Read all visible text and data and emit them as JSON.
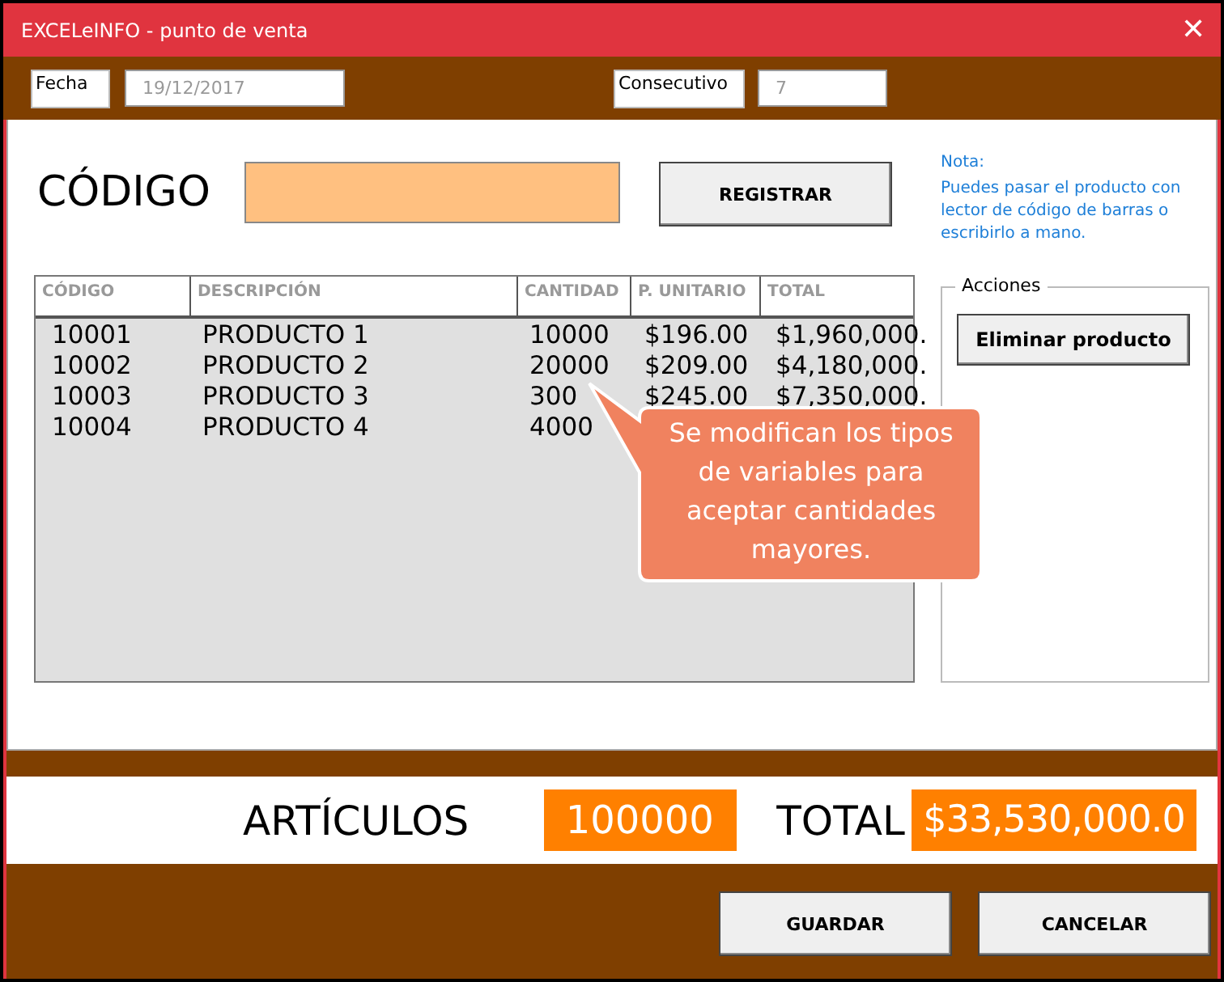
{
  "window": {
    "title": "EXCELeINFO - punto de venta",
    "close_glyph": "✕"
  },
  "header": {
    "date_label": "Fecha",
    "date_value": "19/12/2017",
    "consecutive_label": "Consecutivo",
    "consecutive_value": "7"
  },
  "code": {
    "label": "CÓDIGO",
    "register_button": "REGISTRAR"
  },
  "note": {
    "title": "Nota:",
    "text": "Puedes pasar el producto con lector de código de barras o escribirlo a mano."
  },
  "table": {
    "columns": [
      "CÓDIGO",
      "DESCRIPCIÓN",
      "CANTIDAD",
      "P. UNITARIO",
      "TOTAL"
    ],
    "rows": [
      [
        "10001",
        "PRODUCTO 1",
        "10000",
        "$196.00",
        "$1,960,000."
      ],
      [
        "10002",
        "PRODUCTO 2",
        "20000",
        "$209.00",
        "$4,180,000."
      ],
      [
        "10003",
        "PRODUCTO 3",
        "300",
        "$245.00",
        "$7,350,000."
      ],
      [
        "10004",
        "PRODUCTO 4",
        "4000"
      ]
    ]
  },
  "callout": {
    "text": "Se modifican los tipos de variables para aceptar cantidades mayores."
  },
  "actions": {
    "title": "Acciones",
    "delete_button": "Eliminar producto"
  },
  "totals": {
    "items_label": "ARTÍCULOS",
    "items_value": "100000",
    "total_label": "TOTAL",
    "total_value": "$33,530,000.0"
  },
  "buttons": [
    "GUARDAR",
    "CANCELAR"
  ]
}
